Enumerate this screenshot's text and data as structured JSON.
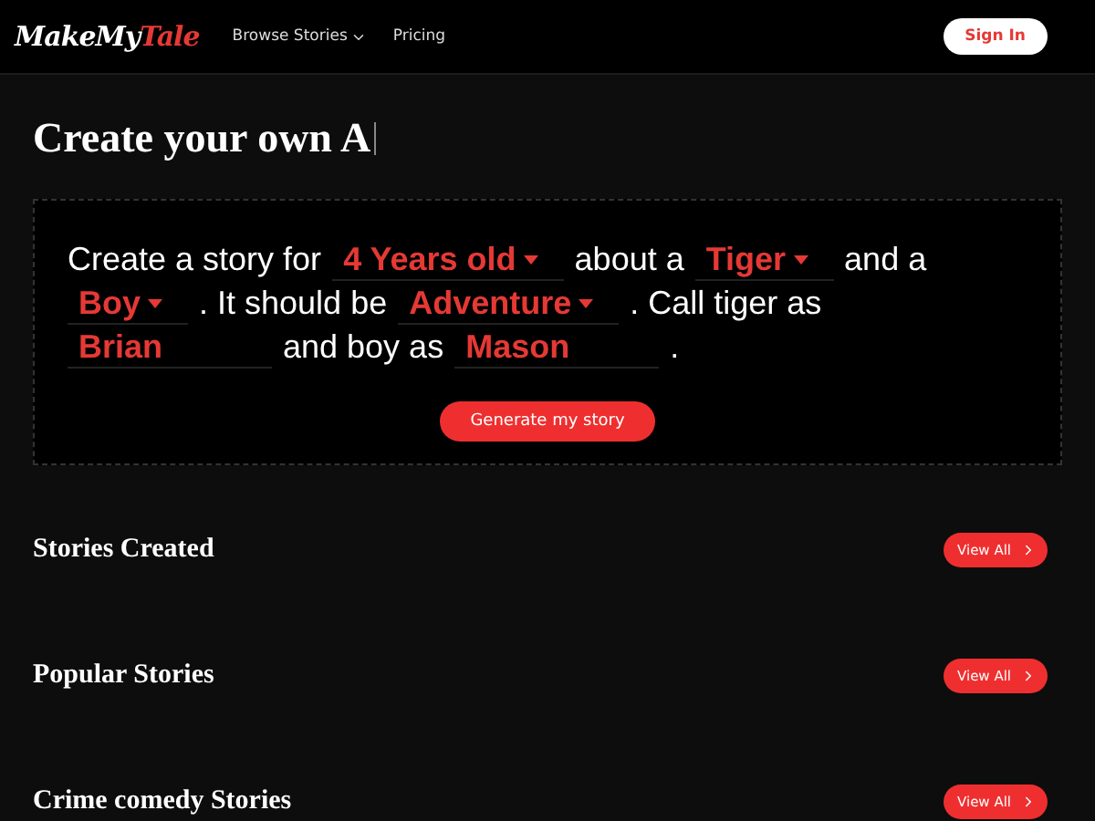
{
  "nav": {
    "logo": {
      "main": "MakeMy",
      "accent": "Tale"
    },
    "links": [
      {
        "label": "Browse Stories",
        "dropdown": true
      },
      {
        "label": "Pricing",
        "dropdown": false
      }
    ],
    "sign_in": "Sign In"
  },
  "heading": "Create your own A",
  "builder": {
    "parts": [
      {
        "kind": "text",
        "text": "Create a story for"
      },
      {
        "kind": "select",
        "value": "4 Years old"
      },
      {
        "kind": "text",
        "text": "about a"
      },
      {
        "kind": "select",
        "value": "Tiger"
      },
      {
        "kind": "text",
        "text": "and a"
      },
      {
        "kind": "select",
        "value": "Boy"
      },
      {
        "kind": "text",
        "text": ". It should be"
      },
      {
        "kind": "select",
        "value": "Adventure"
      },
      {
        "kind": "text",
        "text": ". Call tiger as"
      },
      {
        "kind": "input",
        "value": "Brian"
      },
      {
        "kind": "text",
        "text": "and boy as"
      },
      {
        "kind": "input",
        "value": "Mason"
      },
      {
        "kind": "text",
        "text": "."
      }
    ],
    "button": "Generate my story"
  },
  "sections": [
    {
      "title": "Stories Created",
      "button": "View All"
    },
    {
      "title": "Popular Stories",
      "button": "View All"
    },
    {
      "title": "Crime comedy Stories",
      "button": "View All"
    }
  ]
}
